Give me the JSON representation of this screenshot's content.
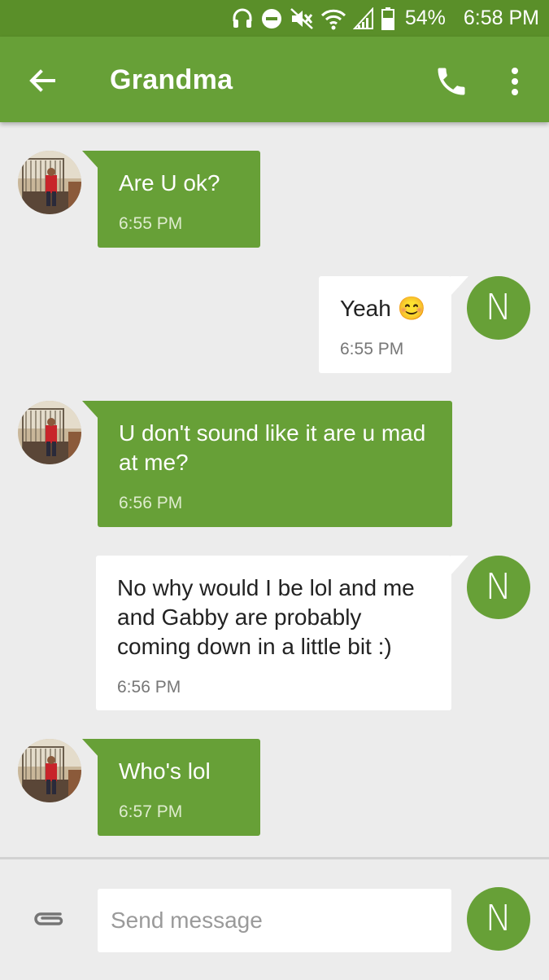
{
  "status_bar": {
    "battery_percent": "54%",
    "time": "6:58 PM",
    "icons": [
      "headset-icon",
      "do-not-disturb-icon",
      "muted-icon",
      "wifi-icon",
      "signal-icon",
      "battery-icon"
    ]
  },
  "header": {
    "title": "Grandma",
    "back_icon": "arrow-left-icon",
    "call_icon": "phone-icon",
    "more_icon": "more-vert-icon"
  },
  "messages": [
    {
      "direction": "incoming",
      "text": "Are U ok?",
      "time": "6:55 PM"
    },
    {
      "direction": "outgoing",
      "text": "Yeah 😊",
      "time": "6:55 PM",
      "avatar": "N"
    },
    {
      "direction": "incoming",
      "text": " U don't sound like it are u mad at me?",
      "time": "6:56 PM"
    },
    {
      "direction": "outgoing",
      "text": "No why would I be lol and me and Gabby are probably coming down in a little bit :)",
      "time": "6:56 PM",
      "avatar": "N"
    },
    {
      "direction": "incoming",
      "text": "Who's lol",
      "time": "6:57 PM"
    }
  ],
  "compose": {
    "placeholder": "Send message",
    "avatar": "N",
    "attach_icon": "paperclip-icon"
  },
  "colors": {
    "status_bar": "#5a8f29",
    "app_bar": "#67a037",
    "incoming_bubble": "#67a037",
    "outgoing_bubble": "#ffffff",
    "background": "#ececec"
  }
}
